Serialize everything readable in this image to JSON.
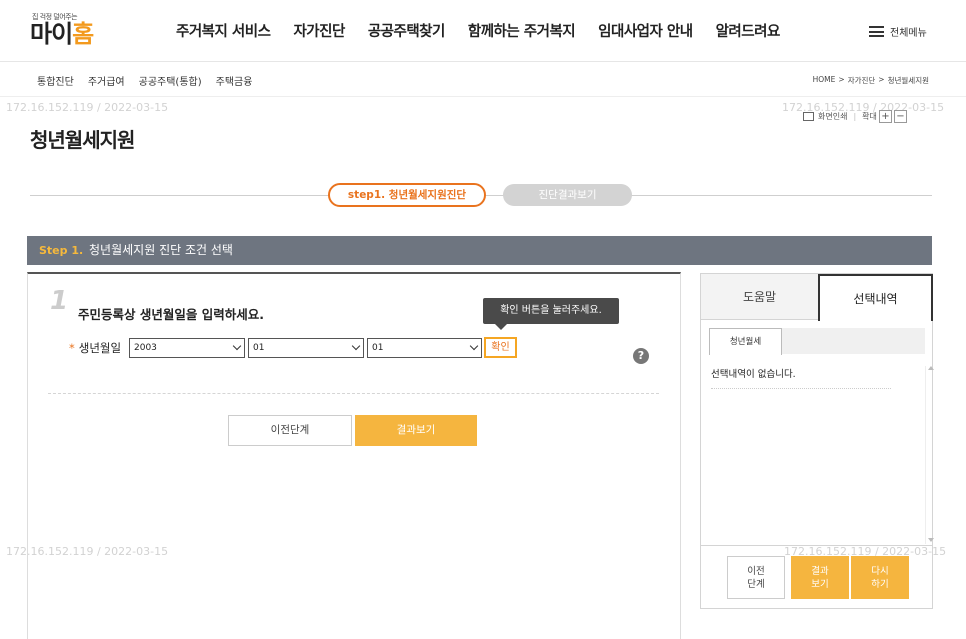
{
  "logo": {
    "tagline": "집 걱정 덜어주는",
    "brand_main": "마이",
    "brand_accent": "홈"
  },
  "gnb": [
    "주거복지 서비스",
    "자가진단",
    "공공주택찾기",
    "함께하는 주거복지",
    "임대사업자 안내",
    "알려드려요"
  ],
  "all_menu": "전체메뉴",
  "subnav": [
    "통합진단",
    "주거급여",
    "공공주택(통합)",
    "주택금융"
  ],
  "breadcrumb": [
    "HOME",
    ">",
    "자가진단",
    ">",
    "청년월세지원"
  ],
  "watermark": "172.16.152.119 / 2022-03-15",
  "page_title": "청년월세지원",
  "tools": {
    "print": "화면인쇄",
    "zoom": "확대",
    "plus": "+",
    "minus": "−"
  },
  "steps": {
    "step1": "step1. 청년월세지원진단",
    "step2": "진단결과보기"
  },
  "section": {
    "step_no": "Step 1.",
    "title": "청년월세지원 진단 조건 선택"
  },
  "question": {
    "number": "1",
    "title": "주민등록상 생년월일을 입력하세요.",
    "required_mark": "*",
    "label": "생년월일",
    "year": "2003",
    "month": "01",
    "day": "01",
    "confirm": "확인",
    "tooltip": "확인 버튼을 눌러주세요.",
    "help": "?"
  },
  "buttons": {
    "prev": "이전단계",
    "result": "결과보기"
  },
  "side": {
    "tab_help": "도움말",
    "tab_selected": "선택내역",
    "inner_tab": "청년월세",
    "empty": "선택내역이 없습니다.",
    "btn_prev": [
      "이전",
      "단계"
    ],
    "btn_result": [
      "결과",
      "보기"
    ],
    "btn_redo": [
      "다시",
      "하기"
    ]
  },
  "colors": {
    "accent": "#e9731e",
    "button": "#f5b53f",
    "section_bar": "#6e7580"
  }
}
